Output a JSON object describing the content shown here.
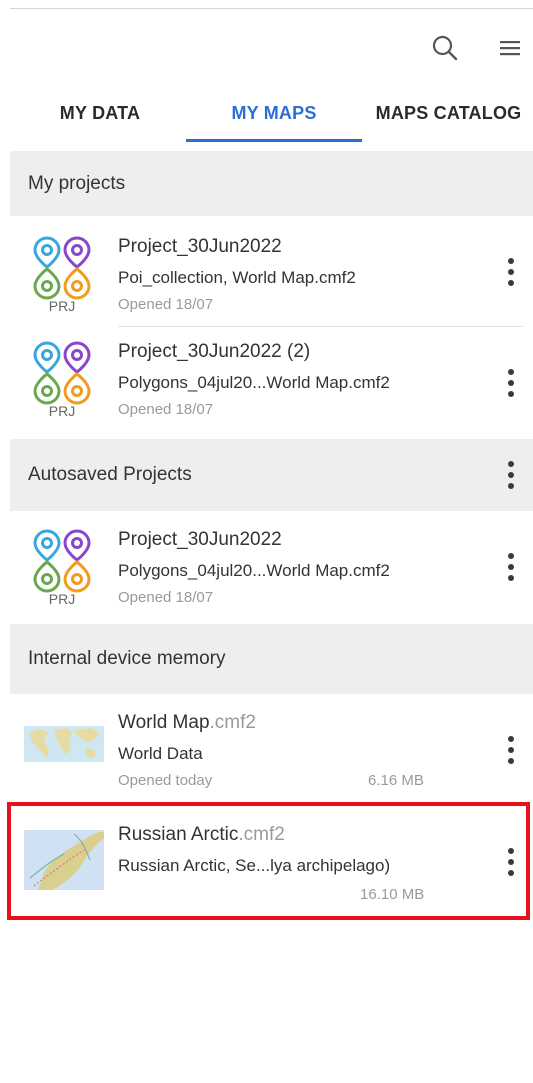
{
  "tabs": [
    {
      "label": "MY DATA",
      "active": false
    },
    {
      "label": "MY MAPS",
      "active": true
    },
    {
      "label": "MAPS CATALOG",
      "active": false
    }
  ],
  "icons": {
    "search": "search-icon",
    "menu": "hamburger-menu-icon",
    "project": "project-pins-icon",
    "more": "more-vert-icon"
  },
  "colors": {
    "accent": "#2b6fd6",
    "pin_blue": "#3aa6e0",
    "pin_purple": "#8a46c9",
    "pin_green": "#6aa84f",
    "pin_orange": "#f29b1d",
    "highlight": "#e8101c"
  },
  "sections": {
    "my_projects": {
      "label": "My projects",
      "items": [
        {
          "icon_label": "PRJ",
          "title": "Project_30Jun2022",
          "subtitle": "Poi_collection, World Map.cmf2",
          "meta": "Opened 18/07"
        },
        {
          "icon_label": "PRJ",
          "title": "Project_30Jun2022 (2)",
          "subtitle": "Polygons_04jul20...World Map.cmf2",
          "meta": "Opened 18/07"
        }
      ]
    },
    "autosaved": {
      "label": "Autosaved Projects",
      "items": [
        {
          "icon_label": "PRJ",
          "title": "Project_30Jun2022",
          "subtitle": "Polygons_04jul20...World Map.cmf2",
          "meta": "Opened 18/07"
        }
      ]
    },
    "internal": {
      "label": "Internal device memory",
      "items": [
        {
          "name": "World Map",
          "ext": ".cmf2",
          "subtitle": "World Data",
          "meta": "Opened today",
          "size": "6.16 MB"
        },
        {
          "name": "Russian Arctic",
          "ext": ".cmf2",
          "subtitle": "Russian Arctic, Se...lya archipelago)",
          "meta": "",
          "size": "16.10 MB"
        }
      ]
    }
  }
}
